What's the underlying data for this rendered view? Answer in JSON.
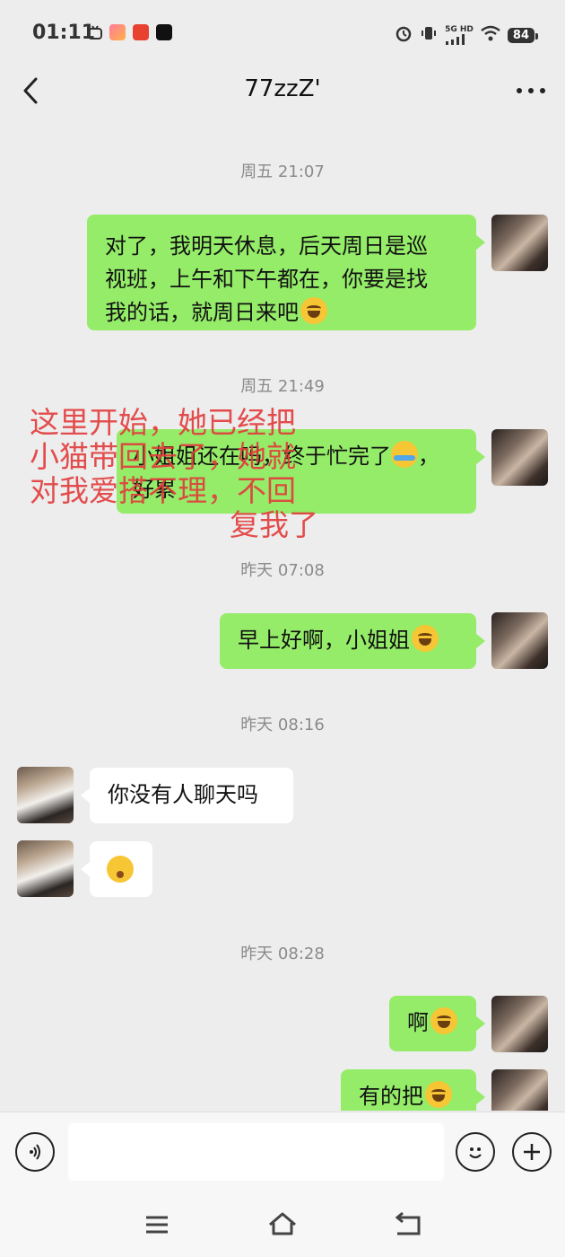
{
  "status_bar": {
    "time": "01:11",
    "network_label_top": "5G HD",
    "battery": "84"
  },
  "header": {
    "title": "77zzZ'"
  },
  "messages": [
    {
      "type": "timestamp",
      "text": "周五 21:07"
    },
    {
      "type": "sent",
      "lines": [
        "对了，我明天休息，后天周日是巡",
        "视班，上午和下午都在，你要是找",
        "我的话，就周日来吧"
      ],
      "emoji": "laughing-tears-emoji"
    },
    {
      "type": "timestamp",
      "text": "周五 21:49"
    },
    {
      "type": "sent",
      "lines": [
        "小姐姐还在吗，终于忙完了",
        "好累"
      ],
      "emoji": "tears-emoji"
    },
    {
      "type": "timestamp",
      "text": "昨天 07:08"
    },
    {
      "type": "sent",
      "lines": [
        "早上好啊，小姐姐"
      ],
      "emoji": "laughing-tears-emoji"
    },
    {
      "type": "timestamp",
      "text": "昨天 08:16"
    },
    {
      "type": "received",
      "lines": [
        "你没有人聊天吗"
      ]
    },
    {
      "type": "received",
      "emoji": "kiss-emoji"
    },
    {
      "type": "timestamp",
      "text": "昨天 08:28"
    },
    {
      "type": "sent",
      "lines": [
        "啊"
      ],
      "emoji": "laughing-tears-emoji"
    },
    {
      "type": "sent",
      "lines": [
        "有的把"
      ],
      "emoji": "laughing-tears-emoji"
    }
  ],
  "annotation": {
    "lines": [
      "这里开始，她已经把",
      "小猫带回去了，她就",
      "对我爱搭不理，不回",
      "复我了"
    ],
    "color": "#e23b3b"
  },
  "input": {
    "placeholder": ""
  },
  "colors": {
    "sent_bubble": "#95ec69",
    "received_bubble": "#ffffff",
    "background": "#ededed"
  }
}
